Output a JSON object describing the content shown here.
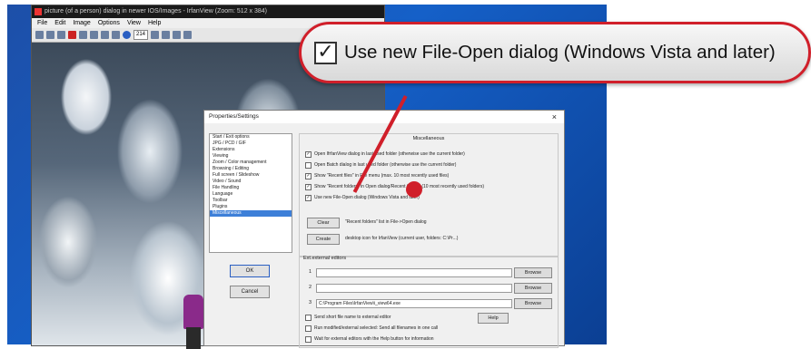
{
  "app": {
    "title": "picture (of a person) dialog in newer IOS/Images - IrfanView (Zoom: 512 x 384)",
    "menu": [
      "File",
      "Edit",
      "Image",
      "Options",
      "View",
      "Help"
    ],
    "zoom_value": "214"
  },
  "dialog": {
    "title": "Properties/Settings",
    "close_glyph": "×",
    "tree": [
      "Start / Exit options",
      "JPG / PCD / GIF",
      "Extensions",
      "Viewing",
      "Zoom / Color management",
      "Browsing / Editing",
      "Full screen / Slideshow",
      "Video / Sound",
      "File Handling",
      "Language",
      "Toolbar",
      "Plugins",
      "Miscellaneous"
    ],
    "selected_index": 12,
    "ok_label": "OK",
    "cancel_label": "Cancel",
    "group_title": "Miscellaneous",
    "checkboxes": [
      {
        "label": "Open IfrfanView dialog in last used folder (otherwise use the current folder)",
        "checked": true
      },
      {
        "label": "Open Batch dialog in last used folder (otherwise use the current folder)",
        "checked": false
      },
      {
        "label": "Show \"Recent files\" in File menu (max. 10 most recently used files)",
        "checked": true
      },
      {
        "label": "Show \"Recent folders\" in Open dialog/Recent folders (10 most recently used folders)",
        "checked": true
      },
      {
        "label": "Use new File-Open dialog (Windows Vista and later)",
        "checked": true
      }
    ],
    "clear_label": "Clear",
    "clear_text": "\"Recent folders\" list in File->Open dialog",
    "create_label": "Create",
    "create_text": "desktop icon for IrfanView (current user, folders: C:\\Pr...)",
    "ext_group_title": "Ext.external editors",
    "ext_editors": [
      {
        "num": "1",
        "value": ""
      },
      {
        "num": "2",
        "value": ""
      },
      {
        "num": "3",
        "value": "C:\\Program Files\\IrfanView\\i_view64.exe"
      }
    ],
    "browse_label": "Browse",
    "ext_check1": "Send short file name to external editor",
    "ext_check2": "Run modified/external selected: Send all filenames in one call",
    "ext_check3": "Wait for external editors with the Help button for information",
    "help_label": "Help"
  },
  "callout": {
    "label": "Use new File-Open dialog (Windows Vista and later)",
    "checkmark": "✓",
    "checked": true
  },
  "colors": {
    "accent_red": "#d01f2a",
    "desktop_blue": "#1560c8"
  }
}
